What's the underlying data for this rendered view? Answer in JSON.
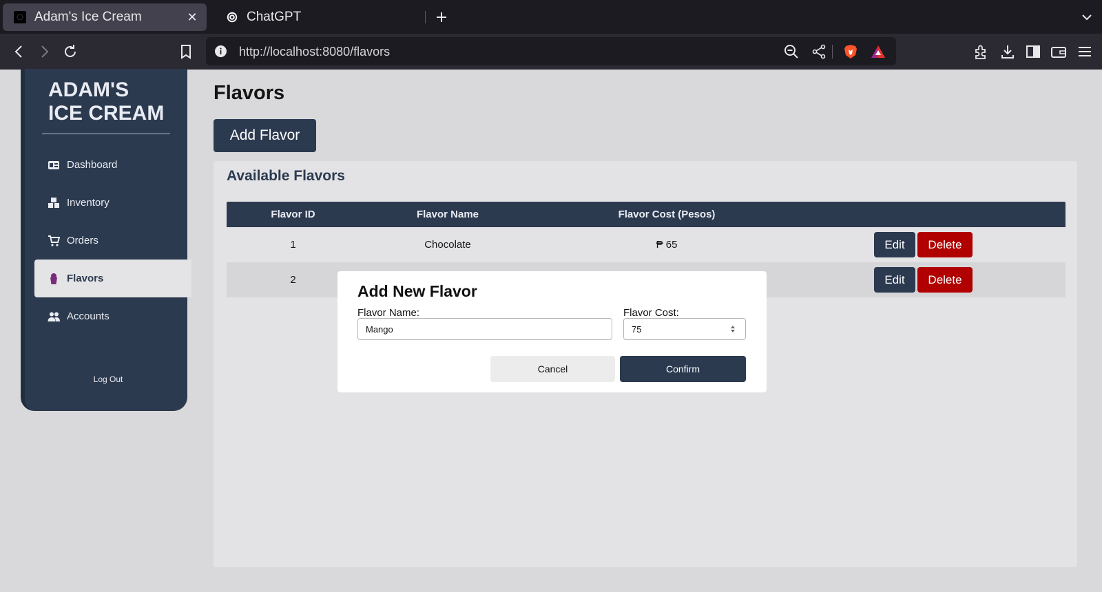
{
  "browser": {
    "tabs": [
      {
        "title": "Adam's Ice Cream",
        "active": true
      },
      {
        "title": "ChatGPT",
        "active": false
      }
    ],
    "close_glyph": "✕",
    "new_tab_glyph": "+",
    "url": "http://localhost:8080/flavors"
  },
  "sidebar": {
    "brand_line1": "ADAM'S",
    "brand_line2": "ICE CREAM",
    "items": [
      {
        "label": "Dashboard",
        "icon": "dashboard-icon"
      },
      {
        "label": "Inventory",
        "icon": "boxes-icon"
      },
      {
        "label": "Orders",
        "icon": "cart-icon"
      },
      {
        "label": "Flavors",
        "icon": "ice-cream-icon",
        "active": true
      },
      {
        "label": "Accounts",
        "icon": "users-icon"
      }
    ],
    "logout": "Log Out"
  },
  "main": {
    "title": "Flavors",
    "add_button": "Add Flavor",
    "card_title": "Available Flavors",
    "columns": [
      "Flavor ID",
      "Flavor Name",
      "Flavor Cost (Pesos)"
    ],
    "rows": [
      {
        "id": "1",
        "name": "Chocolate",
        "cost": "₱ 65"
      },
      {
        "id": "2",
        "name": "",
        "cost": ""
      }
    ],
    "edit_label": "Edit",
    "delete_label": "Delete"
  },
  "modal": {
    "title": "Add New Flavor",
    "name_label": "Flavor Name:",
    "name_value": "Mango",
    "cost_label": "Flavor Cost:",
    "cost_value": "75",
    "cancel": "Cancel",
    "confirm": "Confirm"
  },
  "colors": {
    "navy": "#2c3a50",
    "delete_red": "#b00000",
    "page_bg": "#d9d9db"
  }
}
